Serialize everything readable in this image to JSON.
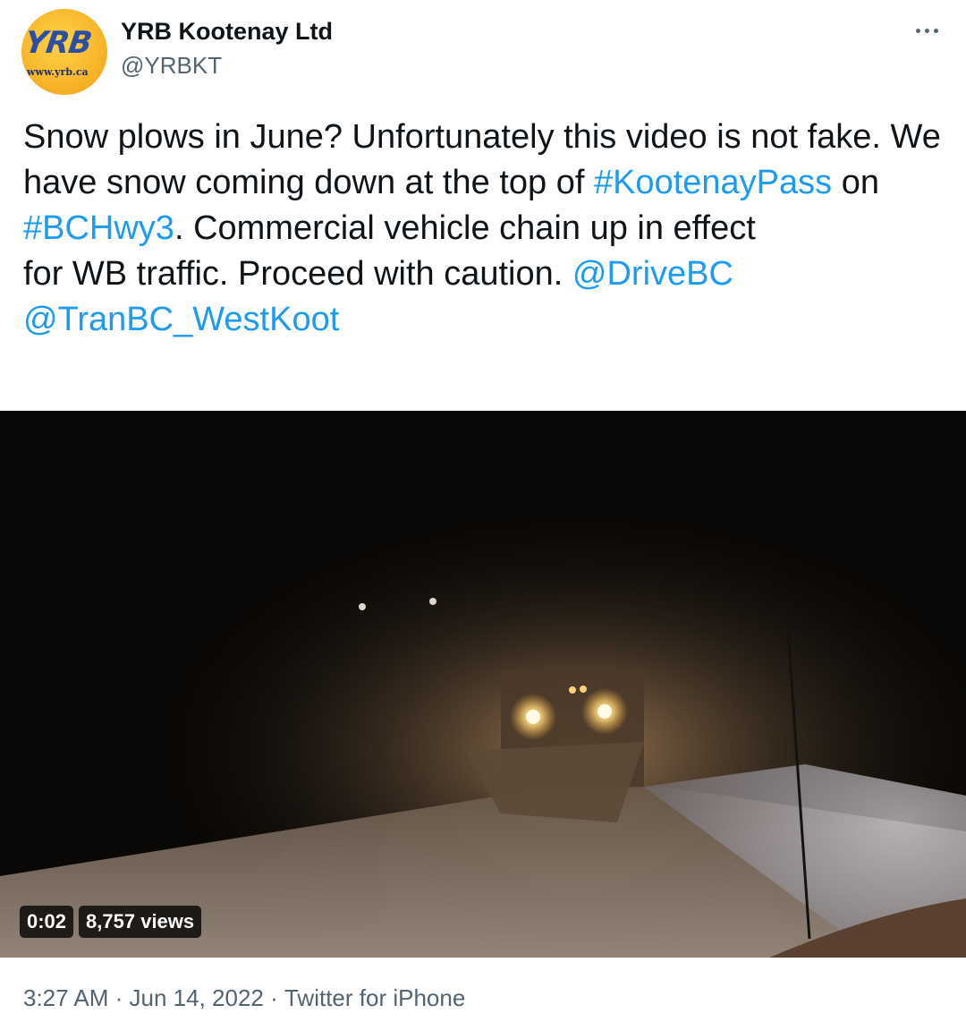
{
  "author": {
    "avatar_logo_text": "YRB",
    "avatar_url_text": "www.yrb.ca",
    "display_name": "YRB Kootenay Ltd",
    "handle": "@YRBKT"
  },
  "tweet": {
    "segments": [
      {
        "text": "Snow plows in June? Unfortunately this video is not fake. We have snow coming down at the top of ",
        "link": false
      },
      {
        "text": "#KootenayPass",
        "link": true
      },
      {
        "text": " on ",
        "link": false
      },
      {
        "text": "#BCHwy3",
        "link": true
      },
      {
        "text": ". Commercial vehicle chain up in effect\nfor WB traffic. Proceed with caution. ",
        "link": false
      },
      {
        "text": "@DriveBC",
        "link": true
      },
      {
        "text": "\n",
        "link": false
      },
      {
        "text": "@TranBC_WestKoot",
        "link": true
      }
    ]
  },
  "video": {
    "elapsed": "0:02",
    "views": "8,757 views"
  },
  "meta": {
    "time": "3:27 AM",
    "separator": " · ",
    "date": "Jun 14, 2022",
    "source": "Twitter for iPhone"
  },
  "colors": {
    "link": "#1d9bf0",
    "secondary": "#536471",
    "avatar_bg": "#f7b52a"
  },
  "icons": {
    "more": "more-horizontal-icon"
  }
}
